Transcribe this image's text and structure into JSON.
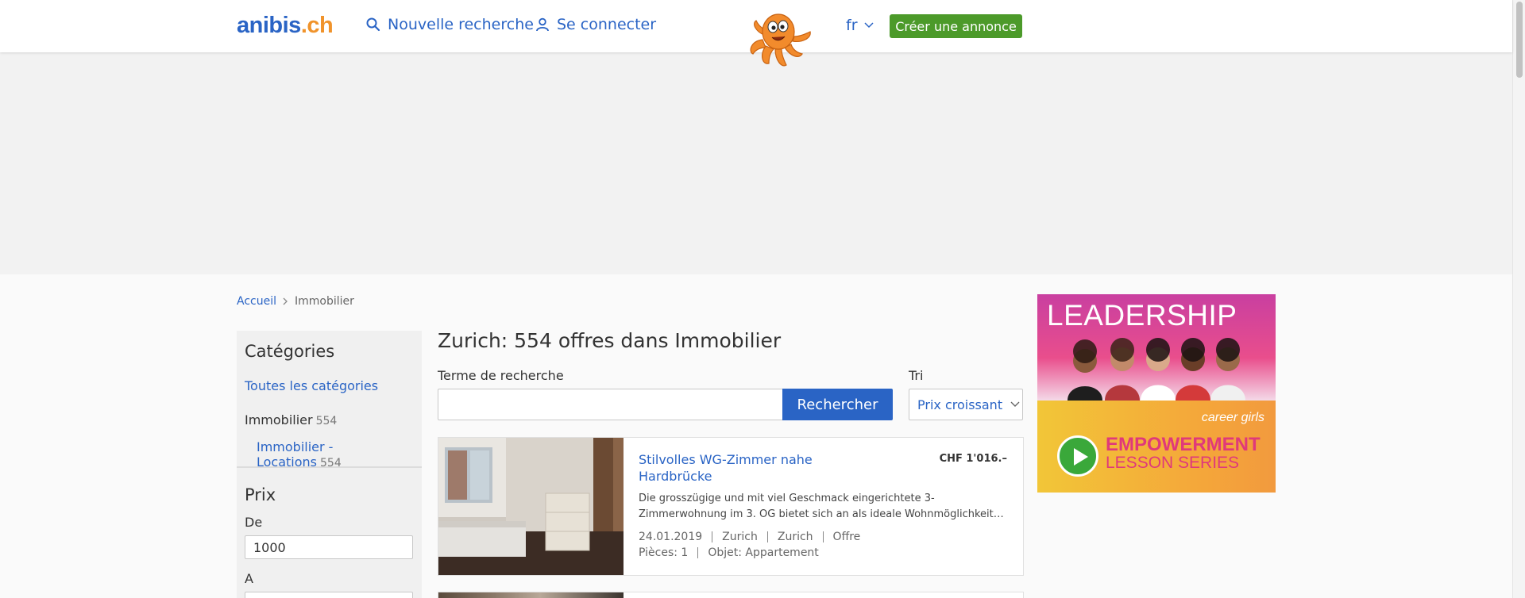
{
  "header": {
    "logo_main": "anibis",
    "logo_tld": ".ch",
    "new_search": "Nouvelle recherche",
    "login": "Se connecter",
    "lang": "fr",
    "create_ad": "Créer une annonce"
  },
  "breadcrumb": {
    "home": "Accueil",
    "current": "Immobilier"
  },
  "sidebar": {
    "categories_title": "Catégories",
    "all_categories": "Toutes les catégories",
    "category": {
      "label": "Immobilier",
      "count": "554"
    },
    "subcategory": {
      "label": "Immobilier - Locations",
      "count": "554"
    },
    "price_title": "Prix",
    "from_label": "De",
    "from_value": "1000",
    "to_label": "A",
    "to_value": ""
  },
  "main": {
    "title": "Zurich: 554 offres dans Immobilier",
    "search_label": "Terme de recherche",
    "search_value": "",
    "search_button": "Rechercher",
    "sort_label": "Tri",
    "sort_value": "Prix croissant"
  },
  "listings": [
    {
      "title": "Stilvolles WG-Zimmer nahe Hardbrücke",
      "price": "CHF 1'016.–",
      "description": "Die grosszügige und mit viel Geschmack eingerichtete 3-Zimmerwohnung im 3. OG bietet sich an als ideale Wohnmöglichkeit…",
      "date": "24.01.2019",
      "city": "Zurich",
      "region": "Zurich",
      "type": "Offre",
      "rooms": "Pièces: 1",
      "object": "Objet: Appartement"
    }
  ],
  "right_ad": {
    "headline": "LEADERSHIP",
    "brand": "career girls",
    "line1": "EMPOWERMENT",
    "line2": "LESSON SERIES"
  },
  "colors": {
    "brand_blue": "#2a64c5",
    "brand_orange": "#f0932b",
    "create_green": "#4c9a2a"
  }
}
